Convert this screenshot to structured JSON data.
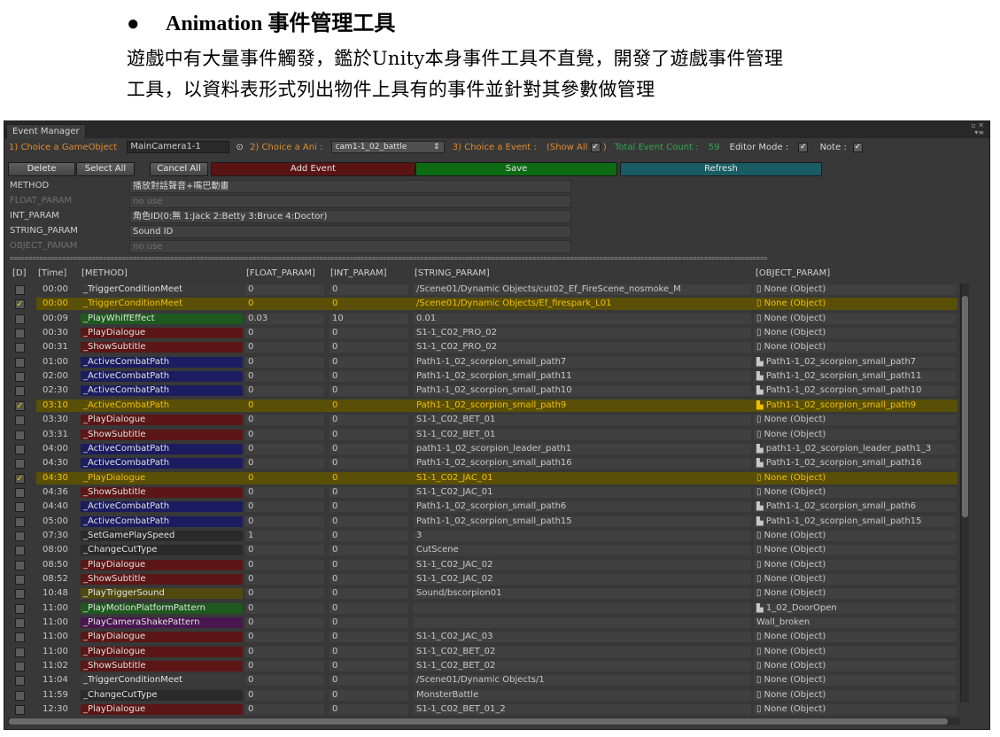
{
  "doc": {
    "bullet": "●",
    "heading": "Animation 事件管理工具",
    "line1": "遊戲中有大量事件觸發，鑑於Unity本身事件工具不直覺，開發了遊戲事件管理",
    "line2": "工具，以資料表形式列出物件上具有的事件並針對其參數做管理"
  },
  "window": {
    "tab": "Event Manager",
    "icons": "▫ ✕",
    "menu_icon": "▾≡"
  },
  "toolbar": {
    "choice_gameobject_label": "1) Choice a GameObject",
    "gameobject_value": "MainCamera1-1",
    "picker_icon": "⊙",
    "choice_ani_label": "2) Choice a Ani :",
    "ani_value": "cam1-1_02_battle",
    "ani_arrow": "⇕",
    "choice_event_label": "3) Choice a Event :",
    "show_all_label": "(Show All",
    "show_all_close": ")",
    "total_count_label": "Total Event Count :",
    "total_count_value": "59",
    "editor_mode_label": "Editor Mode :",
    "note_label": "Note :",
    "checkmark": "✓"
  },
  "buttons": {
    "delete": "Delete",
    "select_all": "Select All",
    "cancel_all": "Cancel All",
    "add_event": "Add Event",
    "save": "Save",
    "refresh": "Refresh"
  },
  "params": [
    {
      "label": "METHOD",
      "value": "播放對話聲音+嘴巴動畫",
      "dim": false
    },
    {
      "label": "FLOAT_PARAM",
      "value": "no use",
      "dim": true
    },
    {
      "label": "INT_PARAM",
      "value": "角色ID(0:無 1:Jack 2:Betty 3:Bruce 4:Doctor)",
      "dim": false
    },
    {
      "label": "STRING_PARAM",
      "value": "Sound ID",
      "dim": false
    },
    {
      "label": "OBJECT_PARAM",
      "value": "no use",
      "dim": true
    }
  ],
  "separator": "===========================================================================================================================================================================================================",
  "columns": {
    "d": "[D]",
    "time": "[Time]",
    "method": "[METHOD]",
    "float": "[FLOAT_PARAM]",
    "int": "[INT_PARAM]",
    "string": "[STRING_PARAM]",
    "object": "[OBJECT_PARAM]"
  },
  "method_colors": {
    "_TriggerConditionMeet": "#3a3a3a",
    "_PlayWhiffEffect": "#1e5a1e",
    "_PlayDialogue": "#5c1616",
    "_ShowSubtitle": "#5c1616",
    "_ActiveCombatPath": "#1c1c60",
    "_SetGamePlaySpeed": "#2a2a2a",
    "_ChangeCutType": "#2a2a2a",
    "_PlayTriggerSound": "#504a10",
    "_PlayMotionPlatformPattern": "#1e5a1e",
    "_PlayCameraShakePattern": "#4a1650"
  },
  "rows": [
    {
      "checked": false,
      "time": "00:00",
      "method": "_TriggerConditionMeet",
      "float": "0",
      "int": "0",
      "string": "/Scene01/Dynamic Objects/cut02_Ef_FireScene_nosmoke_M",
      "object": "▯ None (Object)"
    },
    {
      "checked": true,
      "time": "00:00",
      "method": "_TriggerConditionMeet",
      "float": "0",
      "int": "0",
      "string": "/Scene01/Dynamic Objects/Ef_firespark_L01",
      "object": "▯ None (Object)"
    },
    {
      "checked": false,
      "time": "00:09",
      "method": "_PlayWhiffEffect",
      "float": "0.03",
      "int": "10",
      "string": "0.01",
      "object": "▯ None (Object)"
    },
    {
      "checked": false,
      "time": "00:30",
      "method": "_PlayDialogue",
      "float": "0",
      "int": "0",
      "string": "S1-1_C02_PRO_02",
      "object": "▯ None (Object)"
    },
    {
      "checked": false,
      "time": "00:31",
      "method": "_ShowSubtitle",
      "float": "0",
      "int": "0",
      "string": "S1-1_C02_PRO_02",
      "object": "▯ None (Object)"
    },
    {
      "checked": false,
      "time": "01:00",
      "method": "_ActiveCombatPath",
      "float": "0",
      "int": "0",
      "string": "Path1-1_02_scorpion_small_path7",
      "object": "▙ Path1-1_02_scorpion_small_path7"
    },
    {
      "checked": false,
      "time": "02:00",
      "method": "_ActiveCombatPath",
      "float": "0",
      "int": "0",
      "string": "Path1-1_02_scorpion_small_path11",
      "object": "▙ Path1-1_02_scorpion_small_path11"
    },
    {
      "checked": false,
      "time": "02:30",
      "method": "_ActiveCombatPath",
      "float": "0",
      "int": "0",
      "string": "Path1-1_02_scorpion_small_path10",
      "object": "▙ Path1-1_02_scorpion_small_path10"
    },
    {
      "checked": true,
      "time": "03:10",
      "method": "_ActiveCombatPath",
      "float": "0",
      "int": "0",
      "string": "Path1-1_02_scorpion_small_path9",
      "object": "▙ Path1-1_02_scorpion_small_path9"
    },
    {
      "checked": false,
      "time": "03:30",
      "method": "_PlayDialogue",
      "float": "0",
      "int": "0",
      "string": "S1-1_C02_BET_01",
      "object": "▯ None (Object)"
    },
    {
      "checked": false,
      "time": "03:31",
      "method": "_ShowSubtitle",
      "float": "0",
      "int": "0",
      "string": "S1-1_C02_BET_01",
      "object": "▯ None (Object)"
    },
    {
      "checked": false,
      "time": "04:00",
      "method": "_ActiveCombatPath",
      "float": "0",
      "int": "0",
      "string": "path1-1_02_scorpion_leader_path1",
      "object": "▙ path1-1_02_scorpion_leader_path1_3"
    },
    {
      "checked": false,
      "time": "04:30",
      "method": "_ActiveCombatPath",
      "float": "0",
      "int": "0",
      "string": "Path1-1_02_scorpion_small_path16",
      "object": "▙ Path1-1_02_scorpion_small_path16"
    },
    {
      "checked": true,
      "time": "04:30",
      "method": "_PlayDialogue",
      "float": "0",
      "int": "0",
      "string": "S1-1_C02_JAC_01",
      "object": "▯ None (Object)"
    },
    {
      "checked": false,
      "time": "04:36",
      "method": "_ShowSubtitle",
      "float": "0",
      "int": "0",
      "string": "S1-1_C02_JAC_01",
      "object": "▯ None (Object)"
    },
    {
      "checked": false,
      "time": "04:40",
      "method": "_ActiveCombatPath",
      "float": "0",
      "int": "0",
      "string": "Path1-1_02_scorpion_small_path6",
      "object": "▙ Path1-1_02_scorpion_small_path6"
    },
    {
      "checked": false,
      "time": "05:00",
      "method": "_ActiveCombatPath",
      "float": "0",
      "int": "0",
      "string": "Path1-1_02_scorpion_small_path15",
      "object": "▙ Path1-1_02_scorpion_small_path15"
    },
    {
      "checked": false,
      "time": "07:30",
      "method": "_SetGamePlaySpeed",
      "float": "1",
      "int": "0",
      "string": "3",
      "object": "▯ None (Object)"
    },
    {
      "checked": false,
      "time": "08:00",
      "method": "_ChangeCutType",
      "float": "0",
      "int": "0",
      "string": "CutScene",
      "object": "▯ None (Object)"
    },
    {
      "checked": false,
      "time": "08:50",
      "method": "_PlayDialogue",
      "float": "0",
      "int": "0",
      "string": "S1-1_C02_JAC_02",
      "object": "▯ None (Object)"
    },
    {
      "checked": false,
      "time": "08:52",
      "method": "_ShowSubtitle",
      "float": "0",
      "int": "0",
      "string": "S1-1_C02_JAC_02",
      "object": "▯ None (Object)"
    },
    {
      "checked": false,
      "time": "10:48",
      "method": "_PlayTriggerSound",
      "float": "0",
      "int": "0",
      "string": "Sound/bscorpion01",
      "object": "▯ None (Object)"
    },
    {
      "checked": false,
      "time": "11:00",
      "method": "_PlayMotionPlatformPattern",
      "float": "0",
      "int": "0",
      "string": "",
      "object": "▙ 1_02_DoorOpen"
    },
    {
      "checked": false,
      "time": "11:00",
      "method": "_PlayCameraShakePattern",
      "float": "0",
      "int": "0",
      "string": "",
      "object": "Wall_broken"
    },
    {
      "checked": false,
      "time": "11:00",
      "method": "_PlayDialogue",
      "float": "0",
      "int": "0",
      "string": "S1-1_C02_JAC_03",
      "object": "▯ None (Object)"
    },
    {
      "checked": false,
      "time": "11:00",
      "method": "_PlayDialogue",
      "float": "0",
      "int": "0",
      "string": "S1-1_C02_BET_02",
      "object": "▯ None (Object)"
    },
    {
      "checked": false,
      "time": "11:02",
      "method": "_ShowSubtitle",
      "float": "0",
      "int": "0",
      "string": "S1-1_C02_BET_02",
      "object": "▯ None (Object)"
    },
    {
      "checked": false,
      "time": "11:04",
      "method": "_TriggerConditionMeet",
      "float": "0",
      "int": "0",
      "string": "/Scene01/Dynamic Objects/1",
      "object": "▯ None (Object)"
    },
    {
      "checked": false,
      "time": "11:59",
      "method": "_ChangeCutType",
      "float": "0",
      "int": "0",
      "string": "MonsterBattle",
      "object": "▯ None (Object)"
    },
    {
      "checked": false,
      "time": "12:30",
      "method": "_PlayDialogue",
      "float": "0",
      "int": "0",
      "string": "S1-1_C02_BET_01_2",
      "object": "▯ None (Object)"
    }
  ]
}
